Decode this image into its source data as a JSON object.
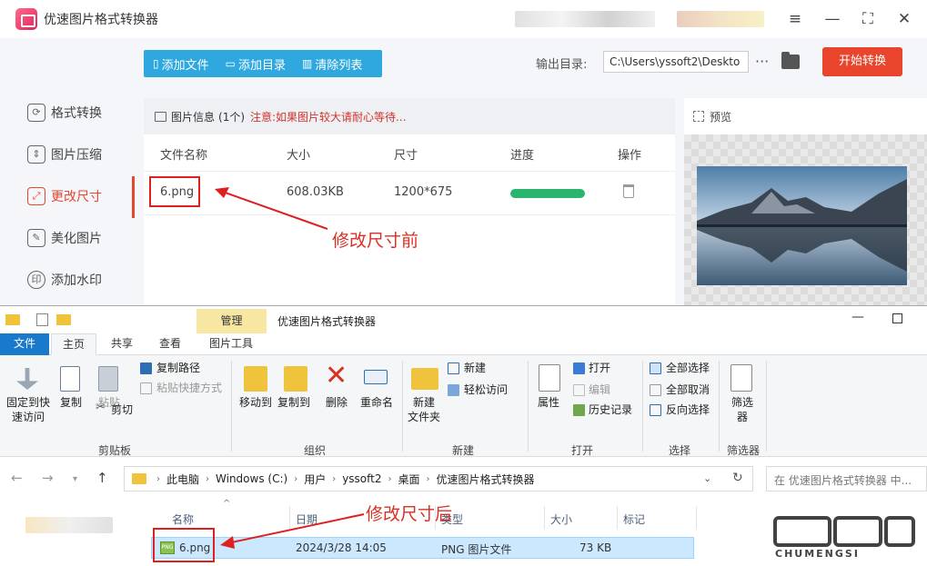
{
  "app": {
    "title": "优速图片格式转换器",
    "sidebar": [
      {
        "label": "格式转换",
        "icon": "format-convert-icon"
      },
      {
        "label": "图片压缩",
        "icon": "compress-icon"
      },
      {
        "label": "更改尺寸",
        "icon": "resize-icon",
        "active": true
      },
      {
        "label": "美化图片",
        "icon": "beautify-icon"
      },
      {
        "label": "添加水印",
        "icon": "watermark-icon"
      }
    ],
    "toolbar": {
      "add_file": "添加文件",
      "add_dir": "添加目录",
      "clear_list": "清除列表"
    },
    "output_label": "输出目录:",
    "output_path": "C:\\Users\\yssoft2\\Deskto",
    "start_button": "开始转换",
    "info": {
      "label": "图片信息",
      "count": "(1个)",
      "warning": "注意:如果图片较大请耐心等待..."
    },
    "columns": {
      "name": "文件名称",
      "size": "大小",
      "dims": "尺寸",
      "progress": "进度",
      "action": "操作"
    },
    "file": {
      "name": "6.png",
      "size": "608.03KB",
      "dims": "1200*675",
      "progress": 1.0
    },
    "preview_label": "预览",
    "annotation": "修改尺寸前"
  },
  "explorer": {
    "context_tab": "管理",
    "title": "优速图片格式转换器",
    "tabs": {
      "file": "文件",
      "home": "主页",
      "share": "共享",
      "view": "查看",
      "pic_tools": "图片工具"
    },
    "ribbon": {
      "pin": "固定到快\n速访问",
      "copy": "复制",
      "paste": "粘贴",
      "copy_path": "复制路径",
      "paste_shortcut": "粘贴快捷方式",
      "cut": "剪切",
      "clipboard": "剪贴板",
      "move_to": "移动到",
      "copy_to": "复制到",
      "delete": "删除",
      "rename": "重命名",
      "organize": "组织",
      "new_folder": "新建\n文件夹",
      "new_item": "新建",
      "easy_access": "轻松访问",
      "new_group": "新建",
      "properties": "属性",
      "open": "打开",
      "edit": "编辑",
      "history": "历史记录",
      "open_group": "打开",
      "select_all": "全部选择",
      "select_none": "全部取消",
      "invert": "反向选择",
      "select_group": "选择",
      "filter": "筛选\n器",
      "filter_group": "筛选器"
    },
    "breadcrumb": [
      "此电脑",
      "Windows (C:)",
      "用户",
      "yssoft2",
      "桌面",
      "优速图片格式转换器"
    ],
    "search_placeholder": "在 优速图片格式转换器 中...",
    "columns": {
      "name": "名称",
      "date": "日期",
      "type": "类型",
      "size": "大小",
      "tags": "标记"
    },
    "file": {
      "name": "6.png",
      "date": "2024/3/28 14:05",
      "type": "PNG 图片文件",
      "size": "73 KB"
    },
    "annotation": "修改尺寸后"
  },
  "watermark": {
    "brand": "CHUMENGSI"
  },
  "colors": {
    "accent": "#e8452c",
    "toolbar": "#2fa8e0",
    "progress": "#2ab56f",
    "annotation": "#d93025",
    "selection": "#cce8ff"
  }
}
